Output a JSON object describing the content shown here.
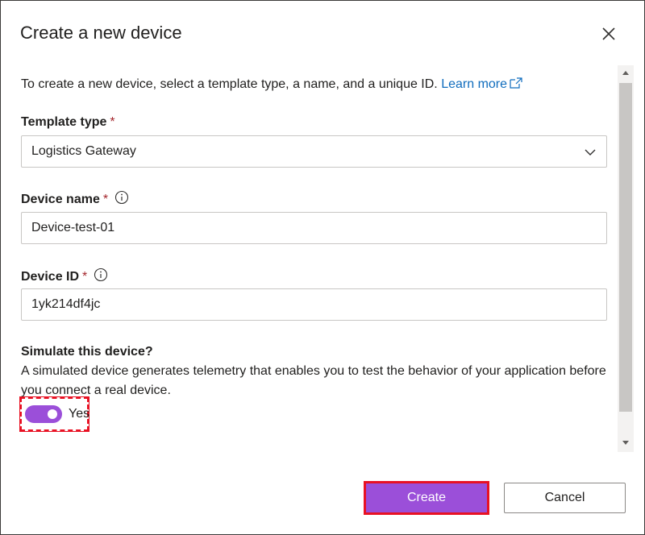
{
  "dialog": {
    "title": "Create a new device",
    "intro_text": "To create a new device, select a template type, a name, and a unique ID.",
    "learn_more": "Learn more"
  },
  "template_type": {
    "label": "Template type",
    "required_mark": "*",
    "value": "Logistics Gateway"
  },
  "device_name": {
    "label": "Device name",
    "required_mark": "*",
    "value": "Device-test-01"
  },
  "device_id": {
    "label": "Device ID",
    "required_mark": "*",
    "value": "1yk214df4jc"
  },
  "simulate": {
    "label": "Simulate this device?",
    "description": "A simulated device generates telemetry that enables you to test the behavior of your application before you connect a real device.",
    "toggle_label": "Yes",
    "toggle_on": true
  },
  "buttons": {
    "create": "Create",
    "cancel": "Cancel"
  },
  "colors": {
    "accent": "#9b4fd9",
    "highlight": "#e81123",
    "link": "#0f6cbd",
    "required": "#a4262c"
  },
  "icons": [
    "close-icon",
    "external-link-icon",
    "chevron-down-icon",
    "info-icon",
    "scroll-up-icon",
    "scroll-down-icon"
  ]
}
